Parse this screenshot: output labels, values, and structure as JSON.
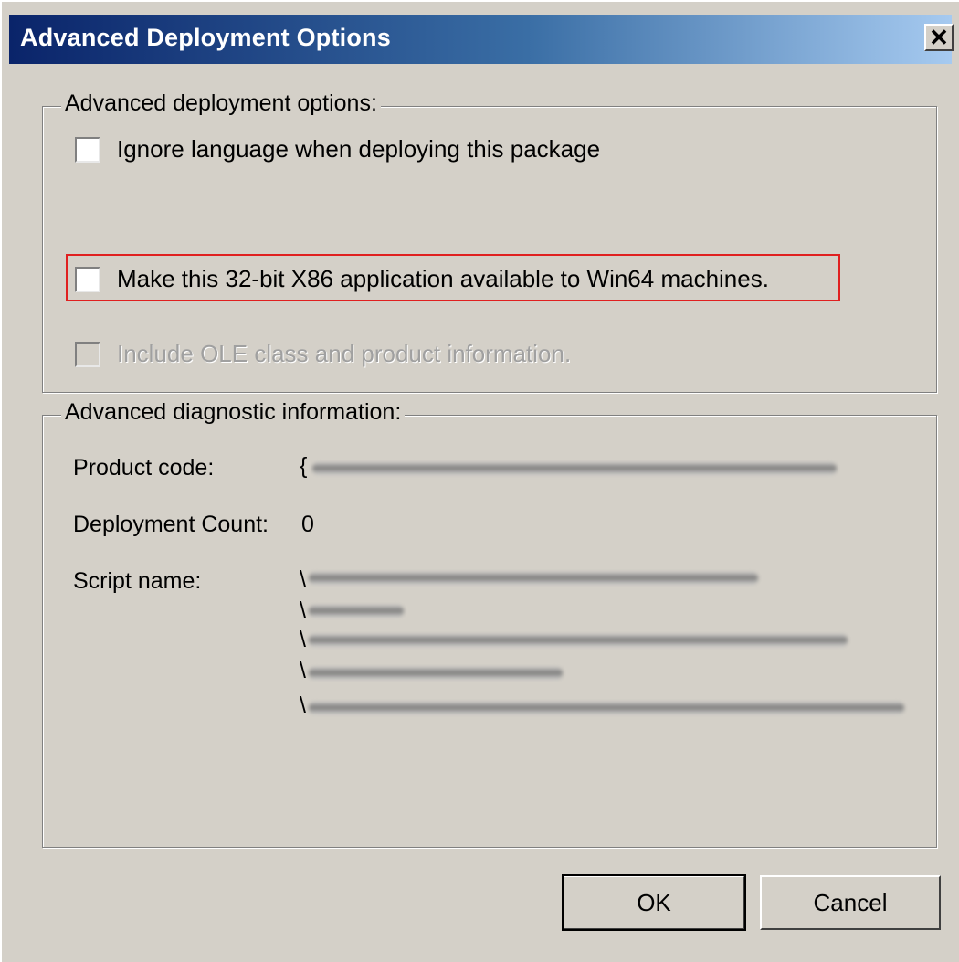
{
  "window": {
    "title": "Advanced Deployment Options",
    "close_label": "✕"
  },
  "deployment_group": {
    "legend": "Advanced deployment options:",
    "options": [
      {
        "label": "Ignore language when deploying this package",
        "checked": false,
        "enabled": true
      },
      {
        "label": "Make this 32-bit X86 application available to Win64 machines.",
        "checked": false,
        "enabled": true,
        "highlighted": true
      },
      {
        "label": "Include OLE class and product information.",
        "checked": false,
        "enabled": false
      }
    ]
  },
  "diagnostic_group": {
    "legend": "Advanced diagnostic information:",
    "product_code_label": "Product code:",
    "product_code_value_prefix": "{",
    "deployment_count_label": "Deployment Count:",
    "deployment_count_value": "0",
    "script_name_label": "Script name:",
    "script_name_prefixes": [
      "\\",
      "\\",
      "\\",
      "\\",
      "\\"
    ]
  },
  "buttons": {
    "ok": "OK",
    "cancel": "Cancel"
  },
  "colors": {
    "highlight": "#e02020",
    "titlebar_start": "#0a246a",
    "titlebar_end": "#a6caf0",
    "face": "#d4d0c8"
  }
}
